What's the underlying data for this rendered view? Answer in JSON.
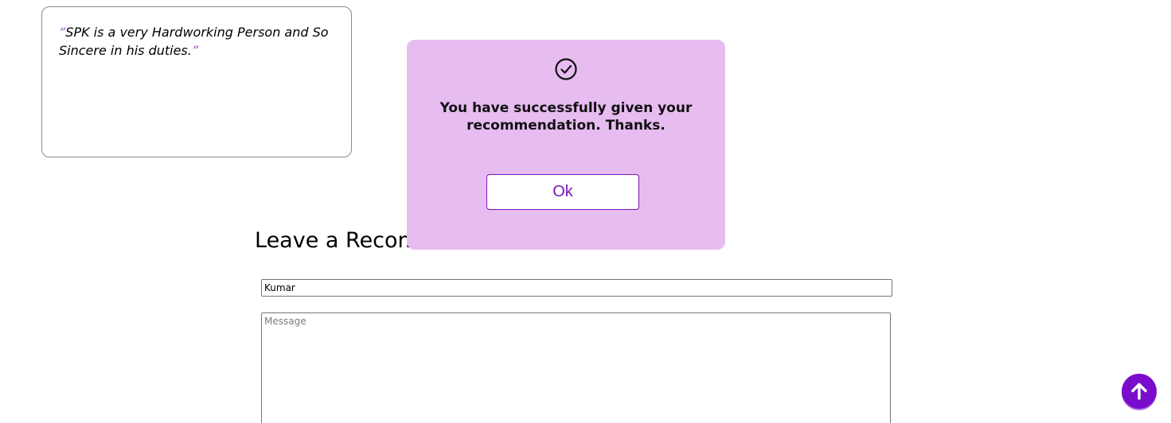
{
  "testimonial": {
    "open_quote": "“",
    "text": "SPK is a very Hardworking Person and So Sincere in his duties.",
    "close_quote": "”"
  },
  "recommendation_form": {
    "heading": "Leave a Recommendation",
    "name_value": "Kumar",
    "message_placeholder": "Message"
  },
  "modal": {
    "icon": "check-circle-icon",
    "message": "You have successfully given your recommendation. Thanks.",
    "ok_label": "Ok"
  },
  "scroll_top": {
    "icon": "arrow-up-icon"
  },
  "colors": {
    "accent": "#7a0ccc",
    "modal_background": "#e7bcf1",
    "quote_mark": "#9e4fd0"
  }
}
